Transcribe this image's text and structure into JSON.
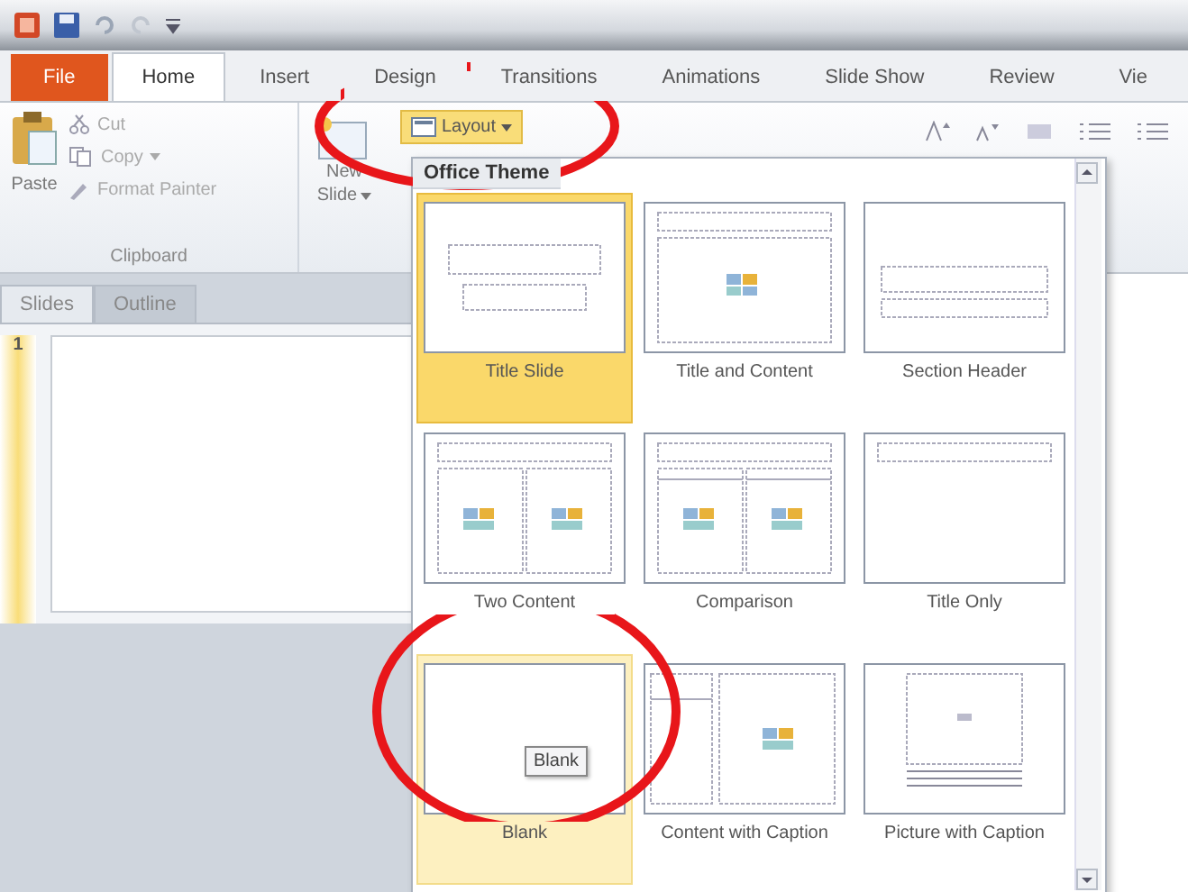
{
  "tabs": [
    {
      "label": "File",
      "kind": "file",
      "selected": false
    },
    {
      "label": "Home",
      "kind": "tab",
      "selected": true
    },
    {
      "label": "Insert",
      "kind": "tab",
      "selected": false
    },
    {
      "label": "Design",
      "kind": "tab",
      "selected": false
    },
    {
      "label": "Transitions",
      "kind": "tab",
      "selected": false
    },
    {
      "label": "Animations",
      "kind": "tab",
      "selected": false
    },
    {
      "label": "Slide Show",
      "kind": "tab",
      "selected": false
    },
    {
      "label": "Review",
      "kind": "tab",
      "selected": false
    },
    {
      "label": "Vie",
      "kind": "tab",
      "selected": false
    }
  ],
  "clipboard": {
    "paste": "Paste",
    "cut": "Cut",
    "copy": "Copy",
    "format_painter": "Format Painter",
    "group_label": "Clipboard"
  },
  "new_slide": {
    "line1": "New",
    "line2": "Slide"
  },
  "layout_button": {
    "label": "Layout",
    "selected": true
  },
  "pane_tabs": [
    {
      "label": "Slides",
      "selected": true
    },
    {
      "label": "Outline",
      "selected": false
    }
  ],
  "slide_number": "1",
  "gallery": {
    "heading": "Office Theme",
    "layouts": [
      {
        "label": "Title Slide",
        "kind": "title",
        "selected": true,
        "hovered": false
      },
      {
        "label": "Title and Content",
        "kind": "title-content",
        "selected": false,
        "hovered": false
      },
      {
        "label": "Section Header",
        "kind": "section",
        "selected": false,
        "hovered": false
      },
      {
        "label": "Two Content",
        "kind": "two-content",
        "selected": false,
        "hovered": false
      },
      {
        "label": "Comparison",
        "kind": "comparison",
        "selected": false,
        "hovered": false
      },
      {
        "label": "Title Only",
        "kind": "title-only",
        "selected": false,
        "hovered": false
      },
      {
        "label": "Blank",
        "kind": "blank",
        "selected": false,
        "hovered": true
      },
      {
        "label": "Content with Caption",
        "kind": "content-caption",
        "selected": false,
        "hovered": false
      },
      {
        "label": "Picture with Caption",
        "kind": "picture-caption",
        "selected": false,
        "hovered": false
      }
    ],
    "tooltip": "Blank"
  }
}
